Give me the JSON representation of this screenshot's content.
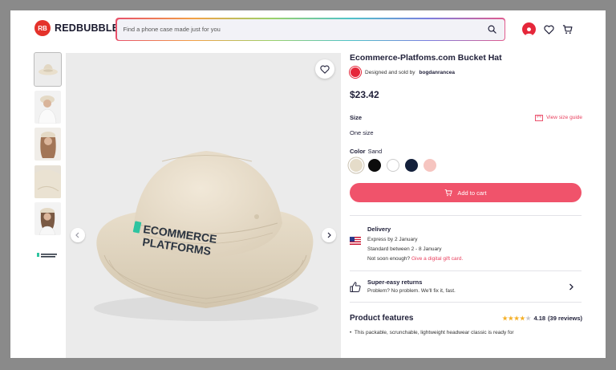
{
  "header": {
    "brand": "REDBUBBLE",
    "logo_mark": "RB",
    "search_placeholder": "Find a phone case made just for you",
    "icons": [
      "search-icon",
      "account-icon",
      "heart-icon",
      "cart-icon"
    ]
  },
  "gallery": {
    "thumbnail_count": 6,
    "hat_logo_line1": "ECOMMERCE",
    "hat_logo_line2": "PLATFORMS"
  },
  "product": {
    "title": "Ecommerce-Platfoms.com Bucket Hat",
    "seller_prefix": "Designed and sold by",
    "seller_name": "bogdanrancea",
    "price": "$23.42",
    "size_label": "Size",
    "size_guide_label": "View size guide",
    "size_value": "One size",
    "color_label": "Color",
    "color_selected": "Sand",
    "colors": [
      "#e5dcc9",
      "#0c0c0c",
      "#ffffff",
      "#14203b",
      "#f6c5c0"
    ],
    "add_to_cart": "Add to cart"
  },
  "delivery": {
    "title": "Delivery",
    "express": "Express by 2 January",
    "standard": "Standard between 2 - 8 January",
    "not_soon": "Not soon enough?",
    "gift_link": "Give a digital gift card."
  },
  "returns": {
    "title": "Super-easy returns",
    "text": "Problem? No problem. We'll fix it, fast."
  },
  "features": {
    "title": "Product features",
    "rating": 4.18,
    "rating_text": "4.18",
    "reviews": "(39 reviews)",
    "bullet": "This packable, scrunchable, lightweight headwear classic is ready for"
  },
  "colors": {
    "accent": "#f0536b",
    "brand_red": "#e4322b",
    "text": "#22223b"
  }
}
